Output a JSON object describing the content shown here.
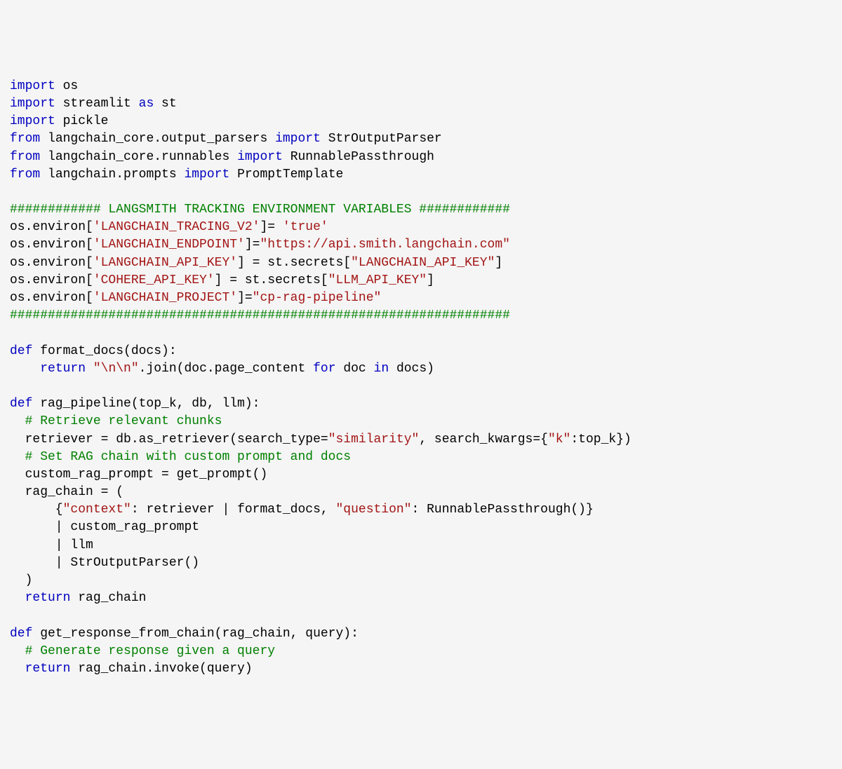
{
  "code": {
    "lines": [
      [
        {
          "t": "kw",
          "v": "import"
        },
        {
          "t": "txt",
          "v": " os"
        }
      ],
      [
        {
          "t": "kw",
          "v": "import"
        },
        {
          "t": "txt",
          "v": " streamlit "
        },
        {
          "t": "kw",
          "v": "as"
        },
        {
          "t": "txt",
          "v": " st"
        }
      ],
      [
        {
          "t": "kw",
          "v": "import"
        },
        {
          "t": "txt",
          "v": " pickle"
        }
      ],
      [
        {
          "t": "kw",
          "v": "from"
        },
        {
          "t": "txt",
          "v": " langchain_core.output_parsers "
        },
        {
          "t": "kw",
          "v": "import"
        },
        {
          "t": "txt",
          "v": " StrOutputParser"
        }
      ],
      [
        {
          "t": "kw",
          "v": "from"
        },
        {
          "t": "txt",
          "v": " langchain_core.runnables "
        },
        {
          "t": "kw",
          "v": "import"
        },
        {
          "t": "txt",
          "v": " RunnablePassthrough"
        }
      ],
      [
        {
          "t": "kw",
          "v": "from"
        },
        {
          "t": "txt",
          "v": " langchain.prompts "
        },
        {
          "t": "kw",
          "v": "import"
        },
        {
          "t": "txt",
          "v": " PromptTemplate"
        }
      ],
      [
        {
          "t": "txt",
          "v": ""
        }
      ],
      [
        {
          "t": "com",
          "v": "############ LANGSMITH TRACKING ENVIRONMENT VARIABLES ############"
        }
      ],
      [
        {
          "t": "txt",
          "v": "os.environ["
        },
        {
          "t": "str",
          "v": "'LANGCHAIN_TRACING_V2'"
        },
        {
          "t": "txt",
          "v": "]= "
        },
        {
          "t": "str",
          "v": "'true'"
        }
      ],
      [
        {
          "t": "txt",
          "v": "os.environ["
        },
        {
          "t": "str",
          "v": "'LANGCHAIN_ENDPOINT'"
        },
        {
          "t": "txt",
          "v": "]="
        },
        {
          "t": "str",
          "v": "\"https://api.smith.langchain.com\""
        }
      ],
      [
        {
          "t": "txt",
          "v": "os.environ["
        },
        {
          "t": "str",
          "v": "'LANGCHAIN_API_KEY'"
        },
        {
          "t": "txt",
          "v": "] = st.secrets["
        },
        {
          "t": "str",
          "v": "\"LANGCHAIN_API_KEY\""
        },
        {
          "t": "txt",
          "v": "]"
        }
      ],
      [
        {
          "t": "txt",
          "v": "os.environ["
        },
        {
          "t": "str",
          "v": "'COHERE_API_KEY'"
        },
        {
          "t": "txt",
          "v": "] = st.secrets["
        },
        {
          "t": "str",
          "v": "\"LLM_API_KEY\""
        },
        {
          "t": "txt",
          "v": "]"
        }
      ],
      [
        {
          "t": "txt",
          "v": "os.environ["
        },
        {
          "t": "str",
          "v": "'LANGCHAIN_PROJECT'"
        },
        {
          "t": "txt",
          "v": "]="
        },
        {
          "t": "str",
          "v": "\"cp-rag-pipeline\""
        }
      ],
      [
        {
          "t": "com",
          "v": "##################################################################"
        }
      ],
      [
        {
          "t": "txt",
          "v": ""
        }
      ],
      [
        {
          "t": "kw",
          "v": "def"
        },
        {
          "t": "txt",
          "v": " format_docs(docs):"
        }
      ],
      [
        {
          "t": "txt",
          "v": "    "
        },
        {
          "t": "kw",
          "v": "return"
        },
        {
          "t": "txt",
          "v": " "
        },
        {
          "t": "str",
          "v": "\"\\n\\n\""
        },
        {
          "t": "txt",
          "v": ".join(doc.page_content "
        },
        {
          "t": "kw",
          "v": "for"
        },
        {
          "t": "txt",
          "v": " doc "
        },
        {
          "t": "kw",
          "v": "in"
        },
        {
          "t": "txt",
          "v": " docs)"
        }
      ],
      [
        {
          "t": "txt",
          "v": ""
        }
      ],
      [
        {
          "t": "kw",
          "v": "def"
        },
        {
          "t": "txt",
          "v": " rag_pipeline(top_k, db, llm):"
        }
      ],
      [
        {
          "t": "txt",
          "v": "  "
        },
        {
          "t": "com",
          "v": "# Retrieve relevant chunks"
        }
      ],
      [
        {
          "t": "txt",
          "v": "  retriever = db.as_retriever(search_type="
        },
        {
          "t": "str",
          "v": "\"similarity\""
        },
        {
          "t": "txt",
          "v": ", search_kwargs={"
        },
        {
          "t": "str",
          "v": "\"k\""
        },
        {
          "t": "txt",
          "v": ":top_k})"
        }
      ],
      [
        {
          "t": "txt",
          "v": "  "
        },
        {
          "t": "com",
          "v": "# Set RAG chain with custom prompt and docs"
        }
      ],
      [
        {
          "t": "txt",
          "v": "  custom_rag_prompt = get_prompt()"
        }
      ],
      [
        {
          "t": "txt",
          "v": "  rag_chain = ("
        }
      ],
      [
        {
          "t": "txt",
          "v": "      {"
        },
        {
          "t": "str",
          "v": "\"context\""
        },
        {
          "t": "txt",
          "v": ": retriever | format_docs, "
        },
        {
          "t": "str",
          "v": "\"question\""
        },
        {
          "t": "txt",
          "v": ": RunnablePassthrough()}"
        }
      ],
      [
        {
          "t": "txt",
          "v": "      | custom_rag_prompt"
        }
      ],
      [
        {
          "t": "txt",
          "v": "      | llm"
        }
      ],
      [
        {
          "t": "txt",
          "v": "      | StrOutputParser()"
        }
      ],
      [
        {
          "t": "txt",
          "v": "  )"
        }
      ],
      [
        {
          "t": "txt",
          "v": "  "
        },
        {
          "t": "kw",
          "v": "return"
        },
        {
          "t": "txt",
          "v": " rag_chain"
        }
      ],
      [
        {
          "t": "txt",
          "v": ""
        }
      ],
      [
        {
          "t": "kw",
          "v": "def"
        },
        {
          "t": "txt",
          "v": " get_response_from_chain(rag_chain, query):"
        }
      ],
      [
        {
          "t": "txt",
          "v": "  "
        },
        {
          "t": "com",
          "v": "# Generate response given a query"
        }
      ],
      [
        {
          "t": "txt",
          "v": "  "
        },
        {
          "t": "kw",
          "v": "return"
        },
        {
          "t": "txt",
          "v": " rag_chain.invoke(query)"
        }
      ]
    ]
  }
}
